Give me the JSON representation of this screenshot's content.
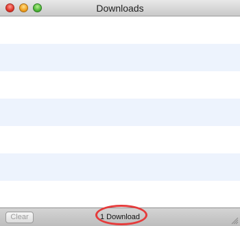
{
  "window": {
    "title": "Downloads"
  },
  "toolbar": {
    "clear_label": "Clear"
  },
  "status": {
    "count_text": "1 Download"
  },
  "colors": {
    "row_alt": "#edf3fd",
    "highlight": "#e53b3b"
  }
}
